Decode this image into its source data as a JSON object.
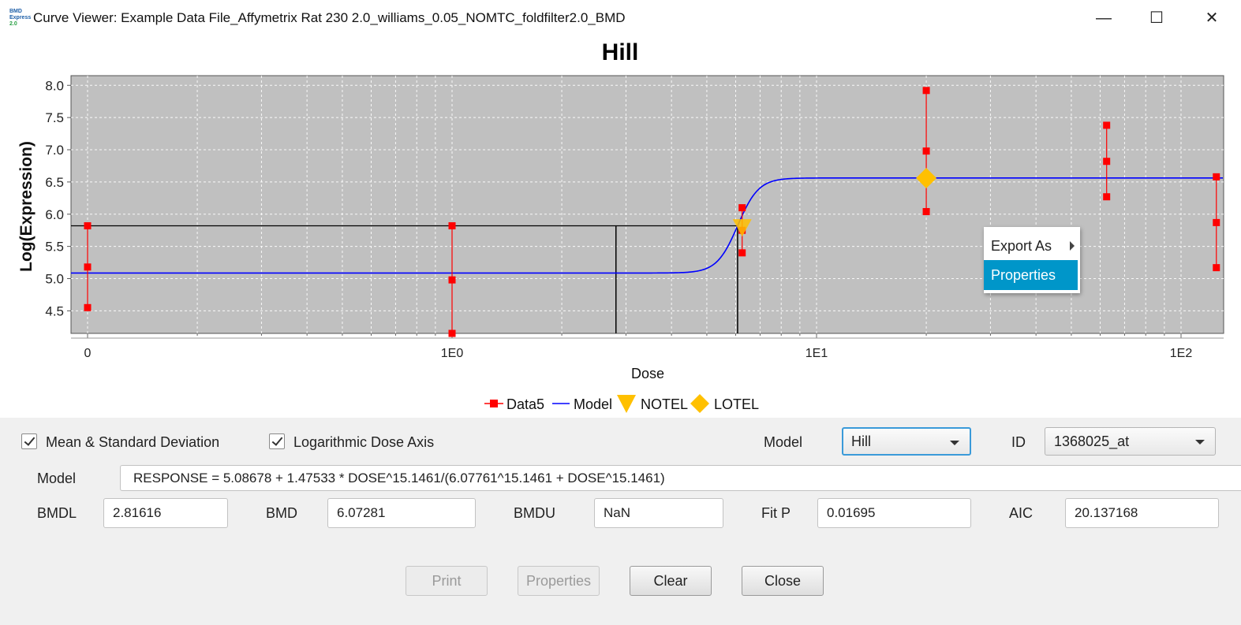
{
  "window": {
    "title": "Curve Viewer: Example Data File_Affymetrix Rat 230 2.0_williams_0.05_NOMTC_foldfilter2.0_BMD",
    "icon_name": "bmd-express-logo-icon",
    "icon_text": [
      "BMD",
      "Express",
      "2.0"
    ],
    "minimize_glyph": "—",
    "maximize_glyph": "☐",
    "close_glyph": "✕"
  },
  "chart_data": {
    "type": "scatter",
    "title": "Hill",
    "xlabel": "Dose",
    "ylabel": "Log(Expression)",
    "x_scale": "log",
    "x_ticks": [
      "0",
      "1E0",
      "1E1",
      "1E2"
    ],
    "y_ticks": [
      "8.0",
      "7.5",
      "7.0",
      "6.5",
      "6.0",
      "5.5",
      "5.0",
      "4.5"
    ],
    "ylim": [
      4.15,
      8.15
    ],
    "grid": true,
    "legend_position": "bottom",
    "legend": [
      "Data5",
      "Model",
      "NOTEL",
      "LOTEL"
    ],
    "series": [
      {
        "name": "Data5",
        "points": [
          {
            "x": 0,
            "y": 5.82
          },
          {
            "x": 0,
            "y": 5.18
          },
          {
            "x": 0,
            "y": 4.55
          },
          {
            "x": 1,
            "y": 5.82
          },
          {
            "x": 1,
            "y": 4.98
          },
          {
            "x": 1,
            "y": 4.15
          },
          {
            "x": 6.25,
            "y": 6.1
          },
          {
            "x": 6.25,
            "y": 5.75
          },
          {
            "x": 6.25,
            "y": 5.4
          },
          {
            "x": 20,
            "y": 7.92
          },
          {
            "x": 20,
            "y": 6.98
          },
          {
            "x": 20,
            "y": 6.04
          },
          {
            "x": 62.5,
            "y": 7.38
          },
          {
            "x": 62.5,
            "y": 6.82
          },
          {
            "x": 62.5,
            "y": 6.27
          },
          {
            "x": 125,
            "y": 6.58
          },
          {
            "x": 125,
            "y": 5.87
          },
          {
            "x": 125,
            "y": 5.17
          }
        ]
      },
      {
        "name": "Model",
        "equation": {
          "intercept": 5.08678,
          "v": 1.47533,
          "n": 15.1461,
          "k": 6.07761
        }
      },
      {
        "name": "NOTEL",
        "points": [
          {
            "x": 6.25,
            "y": 5.8
          }
        ]
      },
      {
        "name": "LOTEL",
        "points": [
          {
            "x": 20,
            "y": 6.56
          }
        ]
      }
    ],
    "bmd_lines": {
      "bmdl": 2.81616,
      "bmd": 6.07281
    }
  },
  "context_menu": {
    "items": [
      {
        "label": "Export As",
        "has_submenu": true
      },
      {
        "label": "Properties",
        "selected": true
      }
    ]
  },
  "options": {
    "mean_sd_label": "Mean & Standard Deviation",
    "mean_sd_checked": true,
    "log_dose_label": "Logarithmic Dose Axis",
    "log_dose_checked": true,
    "model_label": "Model",
    "model_value": "Hill",
    "id_label": "ID",
    "id_value": "1368025_at"
  },
  "fields": {
    "model_eq_label": "Model",
    "model_eq_value": "RESPONSE = 5.08678 + 1.47533 * DOSE^15.1461/(6.07761^15.1461 + DOSE^15.1461)",
    "bmdl_label": "BMDL",
    "bmdl_value": "2.81616",
    "bmd_label": "BMD",
    "bmd_value": "6.07281",
    "bmdu_label": "BMDU",
    "bmdu_value": "NaN",
    "fitp_label": "Fit P",
    "fitp_value": "0.01695",
    "aic_label": "AIC",
    "aic_value": "20.137168"
  },
  "buttons": {
    "print": "Print",
    "properties": "Properties",
    "clear": "Clear",
    "close": "Close"
  },
  "colors": {
    "plot_bg": "#c0c0c0",
    "data": "#ff0000",
    "model": "#0000ff",
    "marker": "#ffc000",
    "menu_selected": "#0096c9"
  }
}
